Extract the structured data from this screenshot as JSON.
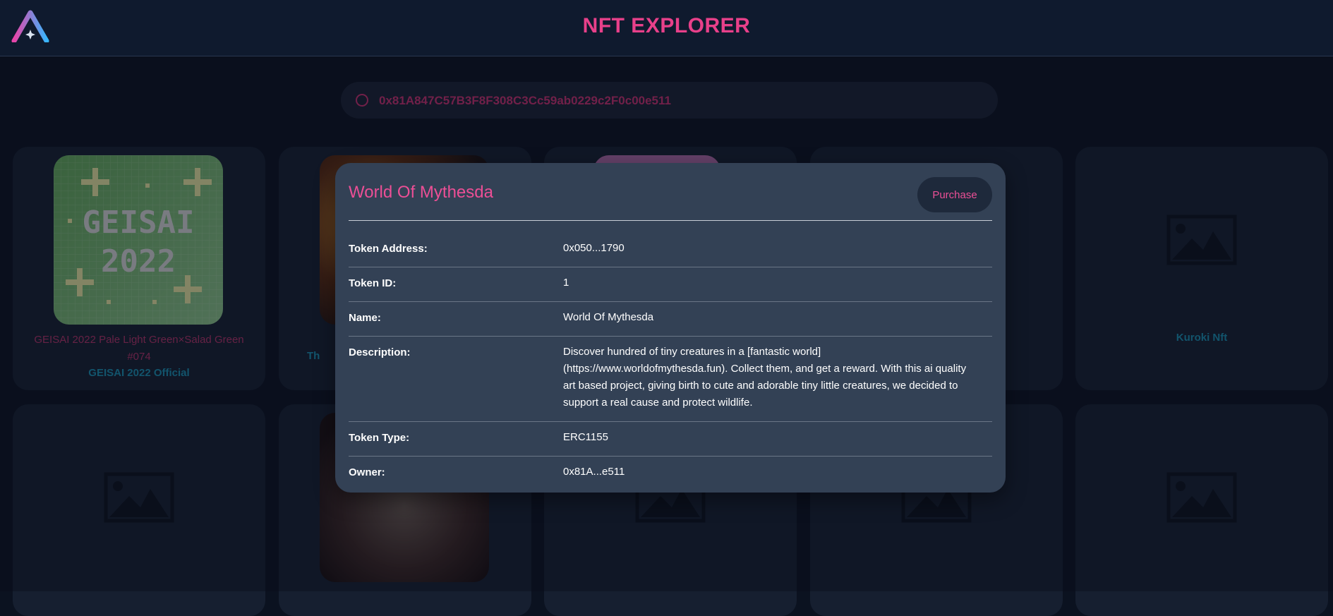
{
  "header": {
    "title": "NFT EXPLORER",
    "logo_icon": "app-logo-icon"
  },
  "search": {
    "value": "0x81A847C57B3F8F308C3Cc59ab0229c2F0c00e511",
    "icon": "search-icon"
  },
  "cards_row1": [
    {
      "title": "GEISAI 2022 Pale Light Green×Salad Green #074",
      "collection": "GEISAI 2022 Official",
      "image_text_1": "GEISAI",
      "image_text_2": "2022"
    },
    {
      "title": "",
      "collection": "Th"
    },
    {
      "title": "",
      "collection": ""
    },
    {
      "title": "",
      "collection": ""
    },
    {
      "title": "",
      "collection": "Kuroki Nft"
    }
  ],
  "modal": {
    "title": "World Of Mythesda",
    "purchase_label": "Purchase",
    "rows": [
      {
        "label": "Token Address:",
        "value": "0x050...1790"
      },
      {
        "label": "Token ID:",
        "value": "1"
      },
      {
        "label": "Name:",
        "value": "World Of Mythesda"
      },
      {
        "label": "Description:",
        "value": "Discover hundred of tiny creatures in a [fantastic world](https://www.worldofmythesda.fun). Collect them, and get a reward. With this ai quality art based project, giving birth to cute and adorable tiny little creatures, we decided to support a real cause and protect wildlife."
      },
      {
        "label": "Token Type:",
        "value": "ERC1155"
      },
      {
        "label": "Owner:",
        "value": "0x81A...e511"
      }
    ]
  },
  "colors": {
    "accent": "#e8408a",
    "collection": "#1a8fb0",
    "modal_bg": "#334155",
    "page_bg": "#0b1220"
  }
}
